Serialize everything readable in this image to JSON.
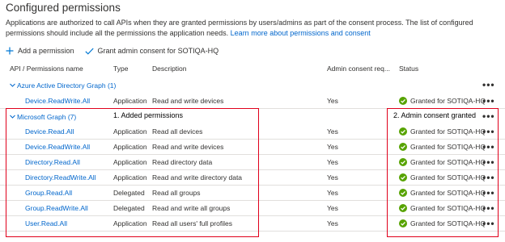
{
  "title": "Configured permissions",
  "intro": {
    "text": "Applications are authorized to call APIs when they are granted permissions by users/admins as part of the consent process. The list of configured permissions should include all the permissions the application needs.",
    "link": "Learn more about permissions and consent"
  },
  "toolbar": {
    "add_label": "Add a permission",
    "grant_label": "Grant admin consent for SOTIQA-HQ"
  },
  "columns": {
    "api": "API / Permissions name",
    "type": "Type",
    "description": "Description",
    "admin": "Admin consent req...",
    "status": "Status"
  },
  "groups": [
    {
      "name": "Azure Active Directory Graph (1)",
      "permissions": [
        {
          "name": "Device.ReadWrite.All",
          "type": "Application",
          "description": "Read and write devices",
          "admin": "Yes",
          "status": "Granted for SOTIQA-HQ"
        }
      ]
    },
    {
      "name": "Microsoft Graph (7)",
      "permissions": [
        {
          "name": "Device.Read.All",
          "type": "Application",
          "description": "Read all devices",
          "admin": "Yes",
          "status": "Granted for SOTIQA-HQ"
        },
        {
          "name": "Device.ReadWrite.All",
          "type": "Application",
          "description": "Read and write devices",
          "admin": "Yes",
          "status": "Granted for SOTIQA-HQ"
        },
        {
          "name": "Directory.Read.All",
          "type": "Application",
          "description": "Read directory data",
          "admin": "Yes",
          "status": "Granted for SOTIQA-HQ"
        },
        {
          "name": "Directory.ReadWrite.All",
          "type": "Application",
          "description": "Read and write directory data",
          "admin": "Yes",
          "status": "Granted for SOTIQA-HQ"
        },
        {
          "name": "Group.Read.All",
          "type": "Delegated",
          "description": "Read all groups",
          "admin": "Yes",
          "status": "Granted for SOTIQA-HQ"
        },
        {
          "name": "Group.ReadWrite.All",
          "type": "Delegated",
          "description": "Read and write all groups",
          "admin": "Yes",
          "status": "Granted for SOTIQA-HQ"
        },
        {
          "name": "User.Read.All",
          "type": "Application",
          "description": "Read all users' full profiles",
          "admin": "Yes",
          "status": "Granted for SOTIQA-HQ"
        }
      ]
    }
  ],
  "more_label": "•••",
  "annotations": {
    "added": "1. Added permissions",
    "granted": "2. Admin consent granted"
  },
  "colors": {
    "link": "#0066cc",
    "accent": "#0078d4",
    "granted_check": "#57a300",
    "annotation_box": "#e0001b",
    "divider": "#e1dfdd"
  },
  "icons": {
    "add": "plus-icon",
    "grant": "checkmark-icon",
    "group_toggle": "chevron-down-icon",
    "status": "check-circle-icon",
    "more": "more-ellipsis-icon"
  }
}
